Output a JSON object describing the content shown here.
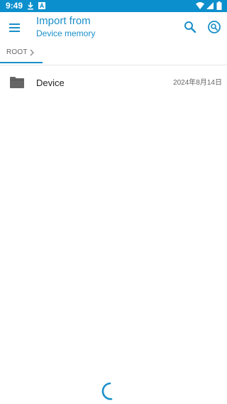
{
  "status_bar": {
    "time": "9:49",
    "icons": [
      "download-icon",
      "notification-app-icon",
      "wifi-icon",
      "signal-icon",
      "battery-icon"
    ]
  },
  "appbar": {
    "title": "Import from",
    "subtitle": "Device memory",
    "icons": [
      "menu-icon",
      "search-icon",
      "scan-search-icon"
    ]
  },
  "breadcrumb": {
    "items": [
      {
        "label": "ROOT"
      }
    ]
  },
  "files": [
    {
      "name": "Device",
      "date": "2024年8月14日",
      "icon": "folder-icon"
    }
  ],
  "colors": {
    "accent": "#1a8fc9",
    "status_bar": "#0b8fcd",
    "folder": "#666666"
  }
}
